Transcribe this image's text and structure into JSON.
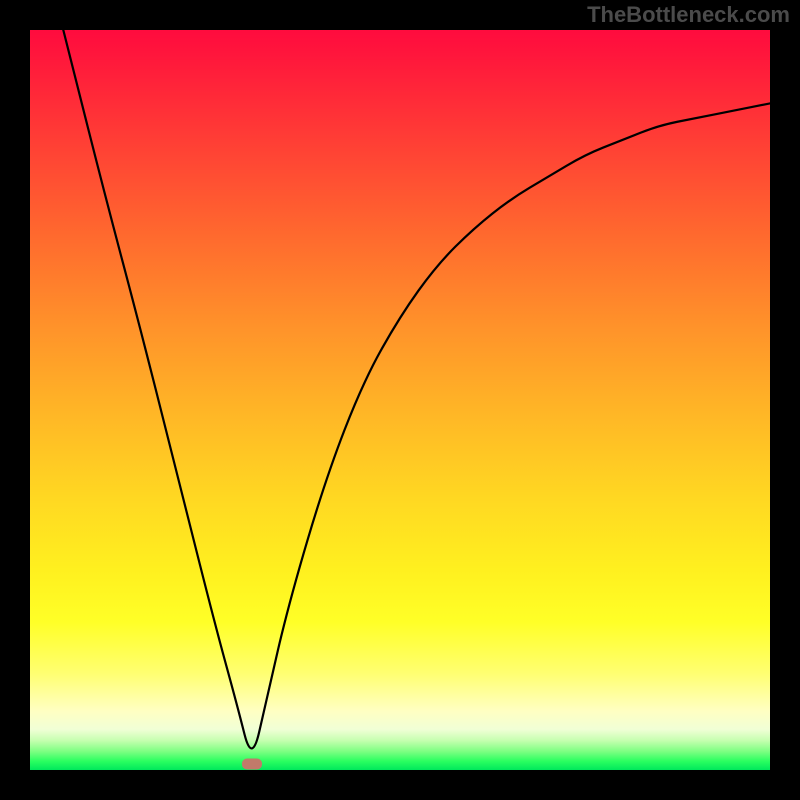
{
  "watermark": "TheBottleneck.com",
  "chart_data": {
    "type": "line",
    "title": "",
    "xlabel": "",
    "ylabel": "",
    "xlim": [
      0,
      100
    ],
    "ylim": [
      0,
      100
    ],
    "grid": false,
    "legend": false,
    "background": "red-yellow-green vertical gradient",
    "series": [
      {
        "name": "bottleneck-curve",
        "description": "V-shaped bottleneck curve reaching 0 near x≈30 and rising steeply on both sides (higher = worse).",
        "x": [
          0,
          5,
          10,
          15,
          20,
          25,
          28,
          30,
          32,
          35,
          40,
          45,
          50,
          55,
          60,
          65,
          70,
          75,
          80,
          85,
          90,
          95,
          100
        ],
        "values": [
          118,
          98,
          78,
          59,
          39,
          19,
          8,
          0,
          9,
          22,
          39,
          52,
          61,
          68,
          73,
          77,
          80,
          83,
          85,
          87,
          88,
          89,
          90
        ]
      }
    ],
    "marker": {
      "x": 30,
      "y": 0,
      "shape": "rounded-rect",
      "color": "#c17a6a"
    }
  }
}
